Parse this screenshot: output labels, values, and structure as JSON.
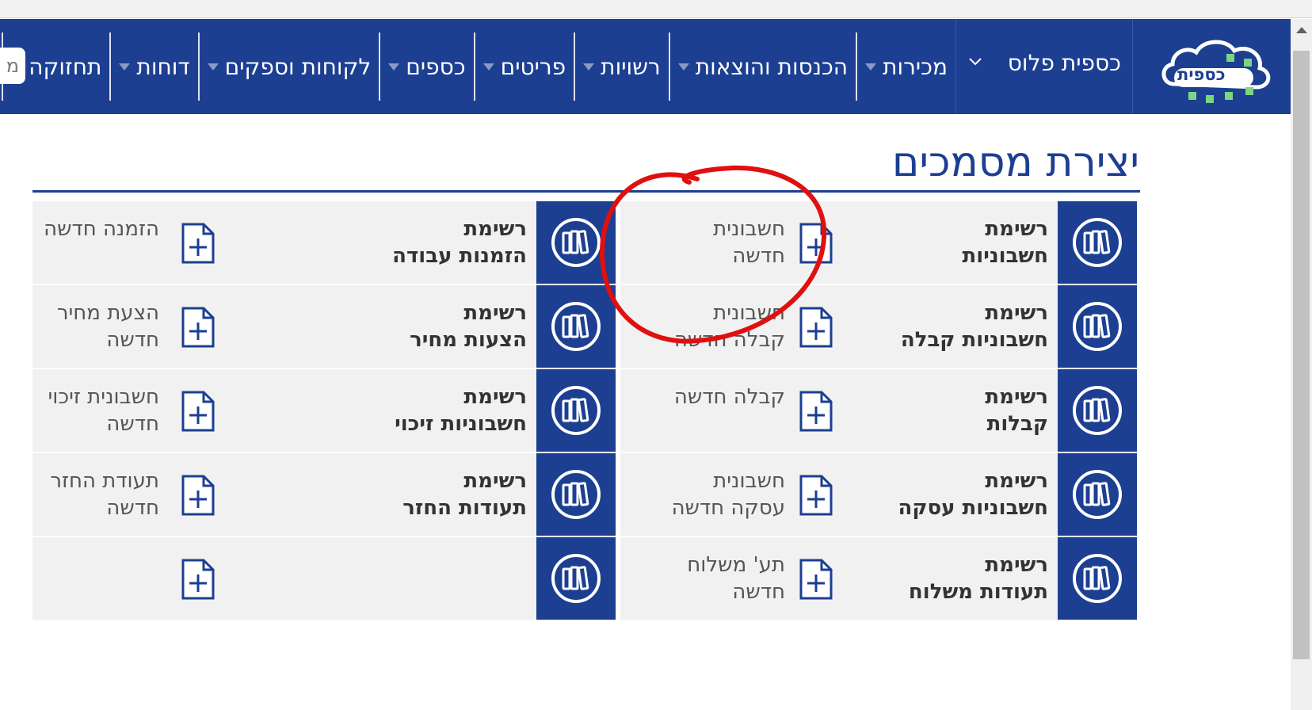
{
  "app": {
    "logo_text": "כספית",
    "brand": "כספית פלוס"
  },
  "nav": {
    "items": [
      {
        "label": "מכירות"
      },
      {
        "label": "הכנסות והוצאות"
      },
      {
        "label": "רשויות"
      },
      {
        "label": "פריטים"
      },
      {
        "label": "כספים"
      },
      {
        "label": "לקוחות וספקים"
      },
      {
        "label": "דוחות"
      },
      {
        "label": "תחזוקה"
      }
    ],
    "search_partial": "מ"
  },
  "page": {
    "title": "יצירת מסמכים"
  },
  "rows": [
    {
      "right_list": {
        "line1": "רשימת",
        "line2": "חשבוניות"
      },
      "right_new": {
        "line1": "חשבונית",
        "line2": "חדשה"
      },
      "left_list": {
        "line1": "רשימת",
        "line2": "הזמנות עבודה"
      },
      "left_new": {
        "line1": "הזמנה חדשה",
        "line2": ""
      }
    },
    {
      "right_list": {
        "line1": "רשימת",
        "line2": "חשבוניות קבלה"
      },
      "right_new": {
        "line1": "חשבונית",
        "line2": "קבלה חדשה"
      },
      "left_list": {
        "line1": "רשימת",
        "line2": "הצעות מחיר"
      },
      "left_new": {
        "line1": "הצעת מחיר",
        "line2": "חדשה"
      }
    },
    {
      "right_list": {
        "line1": "רשימת",
        "line2": "קבלות"
      },
      "right_new": {
        "line1": "קבלה חדשה",
        "line2": ""
      },
      "left_list": {
        "line1": "רשימת",
        "line2": "חשבוניות זיכוי"
      },
      "left_new": {
        "line1": "חשבונית זיכוי",
        "line2": "חדשה"
      }
    },
    {
      "right_list": {
        "line1": "רשימת",
        "line2": "חשבוניות עסקה"
      },
      "right_new": {
        "line1": "חשבונית",
        "line2": "עסקה חדשה"
      },
      "left_list": {
        "line1": "רשימת",
        "line2": "תעודות החזר"
      },
      "left_new": {
        "line1": "תעודת החזר",
        "line2": "חדשה"
      }
    },
    {
      "right_list": {
        "line1": "רשימת",
        "line2": "תעודות משלוח"
      },
      "right_new": {
        "line1": "תע' משלוח",
        "line2": "חדשה"
      },
      "left_list": {
        "line1": "",
        "line2": ""
      },
      "left_new": {
        "line1": "",
        "line2": ""
      }
    }
  ],
  "colors": {
    "brand_blue": "#1c3f91",
    "tile_gray": "#efefef",
    "annotation_red": "#e01010"
  },
  "icons": {
    "list": "books-icon",
    "new": "new-document-icon",
    "nav_dropdown": "caret-down-icon",
    "brand_dropdown": "chevron-down-icon"
  }
}
